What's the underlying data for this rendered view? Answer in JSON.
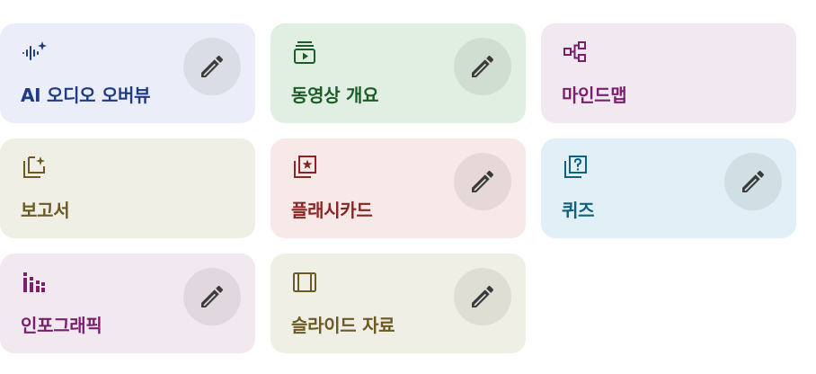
{
  "cards": [
    {
      "id": "audio-overview",
      "label": "AI 오디오 오버뷰",
      "icon": "audio-spark-icon",
      "has_edit": true,
      "accent": "#1f3b82",
      "bg": "#ebedf8"
    },
    {
      "id": "video-overview",
      "label": "동영상 개요",
      "icon": "video-stack-icon",
      "has_edit": true,
      "accent": "#1b5c27",
      "bg": "#e0efe2"
    },
    {
      "id": "mind-map",
      "label": "마인드맵",
      "icon": "mind-map-icon",
      "has_edit": false,
      "accent": "#7a1f6e",
      "bg": "#f1e8f0"
    },
    {
      "id": "report",
      "label": "보고서",
      "icon": "report-spark-icon",
      "has_edit": false,
      "accent": "#6c5a22",
      "bg": "#efefe6"
    },
    {
      "id": "flashcards",
      "label": "플래시카드",
      "icon": "flashcard-star-icon",
      "has_edit": true,
      "accent": "#8c2424",
      "bg": "#f7e9e8"
    },
    {
      "id": "quiz",
      "label": "퀴즈",
      "icon": "quiz-question-icon",
      "has_edit": true,
      "accent": "#10607e",
      "bg": "#e0f0f6"
    },
    {
      "id": "infographic",
      "label": "인포그래픽",
      "icon": "infographic-bars-icon",
      "has_edit": true,
      "accent": "#7a1f6e",
      "bg": "#f1e8f0"
    },
    {
      "id": "slides",
      "label": "슬라이드 자료",
      "icon": "slides-icon",
      "has_edit": true,
      "accent": "#6c5a22",
      "bg": "#efefe6"
    }
  ],
  "edit_icon": "pencil-icon"
}
